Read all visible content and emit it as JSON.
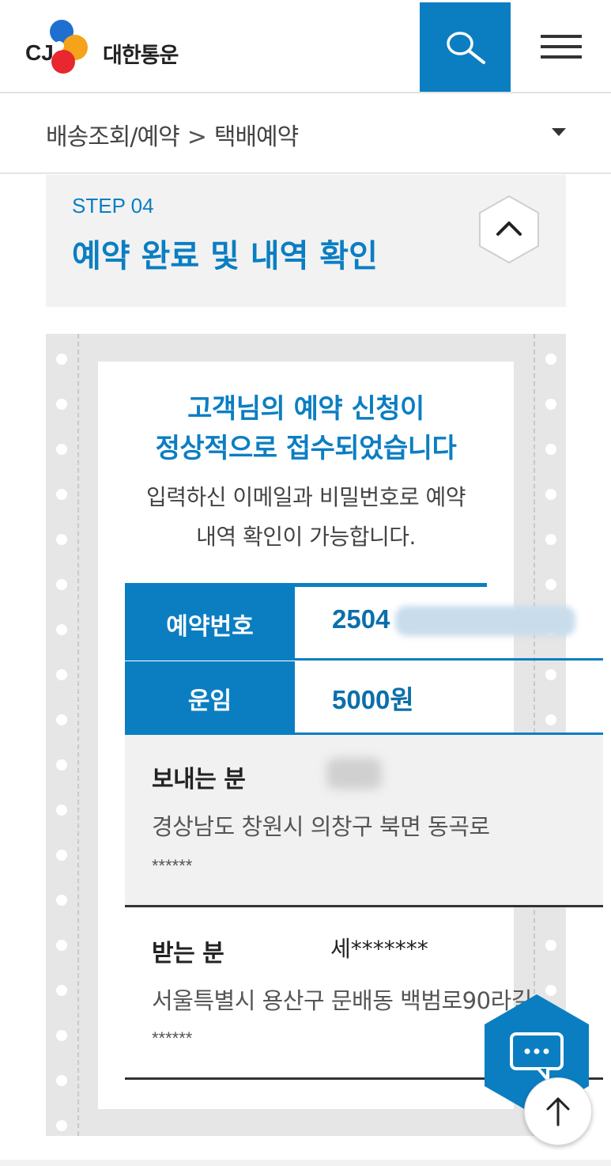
{
  "header": {
    "logo_brand": "CJ",
    "logo_name": "대한통운",
    "search_icon": "search-icon",
    "menu_icon": "hamburger-menu-icon"
  },
  "breadcrumb": {
    "parent": "배송조회/예약",
    "separator": ">",
    "current": "택배예약"
  },
  "step": {
    "label": "STEP 04",
    "title": "예약 완료 및 내역 확인"
  },
  "message": {
    "title_line1": "고객님의 예약 신청이",
    "title_line2": "정상적으로 접수되었습니다",
    "sub_line1": "입력하신 이메일과 비밀번호로 예약",
    "sub_line2": "내역 확인이 가능합니다."
  },
  "reservation": {
    "number_label": "예약번호",
    "number_value": "2504",
    "fee_label": "운임",
    "fee_value": "5000원"
  },
  "sender": {
    "label": "보내는 분",
    "address": "경상남도 창원시 의창구 북면 동곡로",
    "address_detail": "******"
  },
  "receiver": {
    "label": "받는 분",
    "name": "세*******",
    "address": "서울특별시 용산구 문배동 백범로90라길",
    "address_detail": "******"
  },
  "colors": {
    "brand_blue": "#0b7ec2",
    "panel_gray": "#f2f2f2",
    "ticket_gray": "#e6e6e6"
  }
}
